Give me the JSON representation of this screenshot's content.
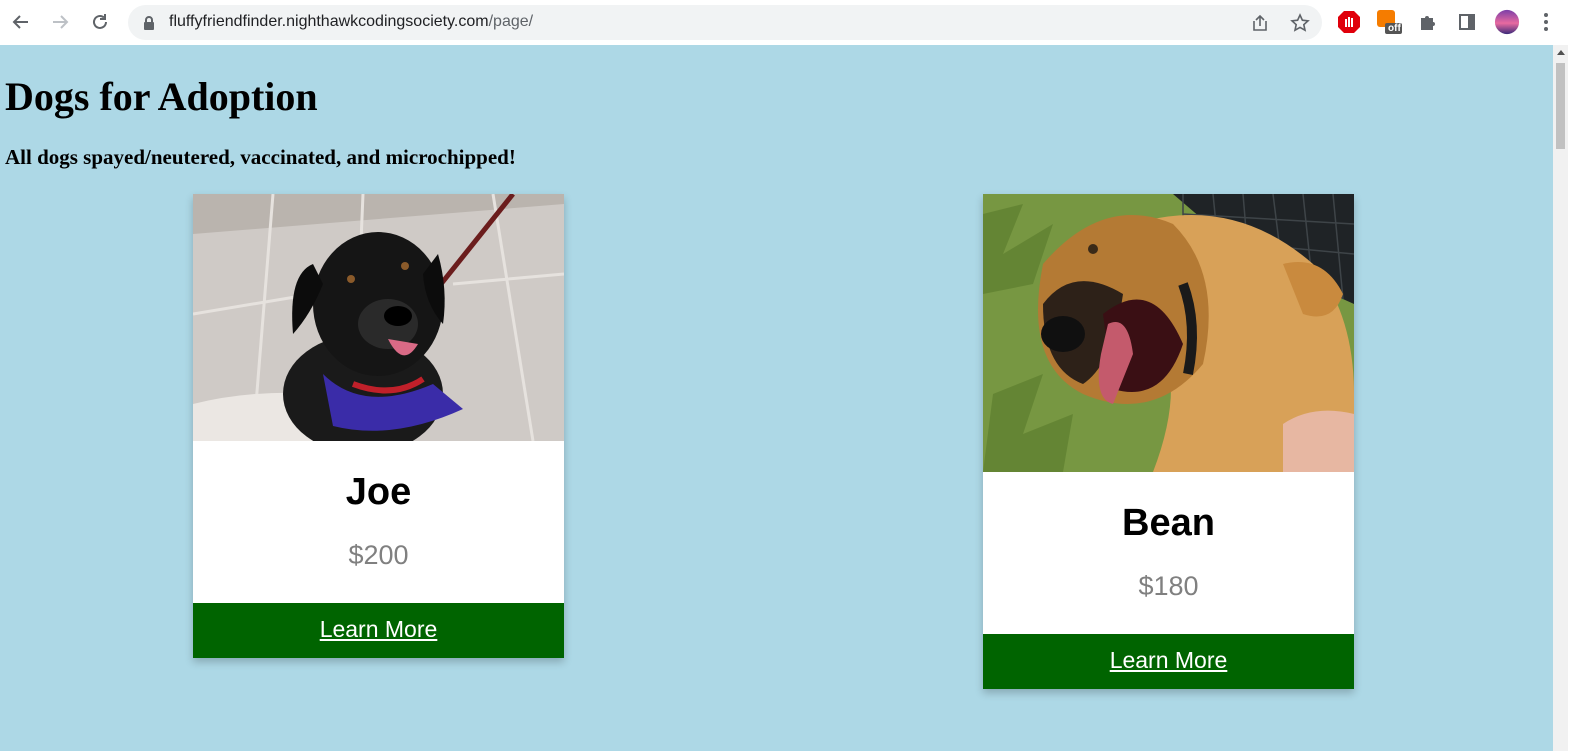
{
  "browser": {
    "url_host": "fluffyfriendfinder.nighthawkcodingsociety.com",
    "url_path": "/page/",
    "extension_badge": "off"
  },
  "page": {
    "title": "Dogs for Adoption",
    "subtitle": "All dogs spayed/neutered, vaccinated, and microchipped!",
    "background": "#add8e6",
    "button_color": "#006400"
  },
  "dogs": [
    {
      "name": "Joe",
      "price": "$200",
      "button_label": "Learn More"
    },
    {
      "name": "Bean",
      "price": "$180",
      "button_label": "Learn More"
    }
  ]
}
